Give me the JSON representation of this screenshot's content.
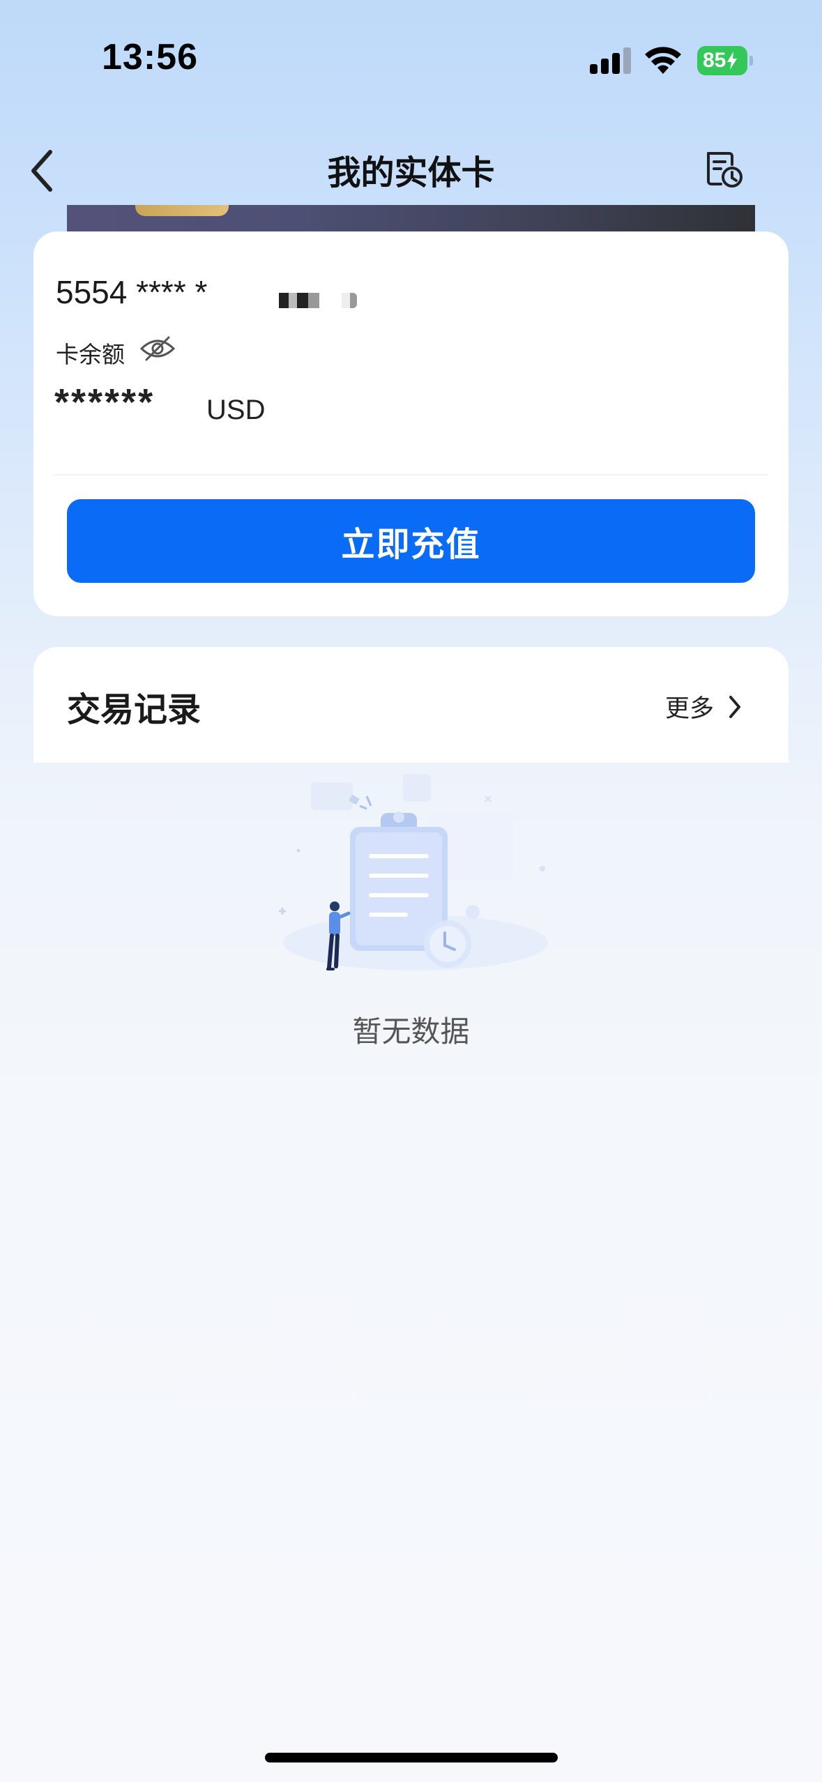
{
  "status_bar": {
    "time": "13:56",
    "battery_percent": "85",
    "battery_charging": true
  },
  "nav": {
    "title": "我的实体卡",
    "back_icon": "chevron-left-icon",
    "history_icon": "card-history-icon"
  },
  "card": {
    "number_masked": "5554 **** *",
    "balance_label": "卡余额",
    "balance_hidden_value": "******",
    "currency": "USD",
    "visibility_icon": "eye-off-icon",
    "recharge_label": "立即充值"
  },
  "transactions": {
    "title": "交易记录",
    "more_label": "更多",
    "empty_text": "暂无数据"
  },
  "colors": {
    "primary": "#0a6cf6",
    "battery_green": "#34c759",
    "card_dark": "#3f4256",
    "chip_gold": "#d4b068"
  }
}
